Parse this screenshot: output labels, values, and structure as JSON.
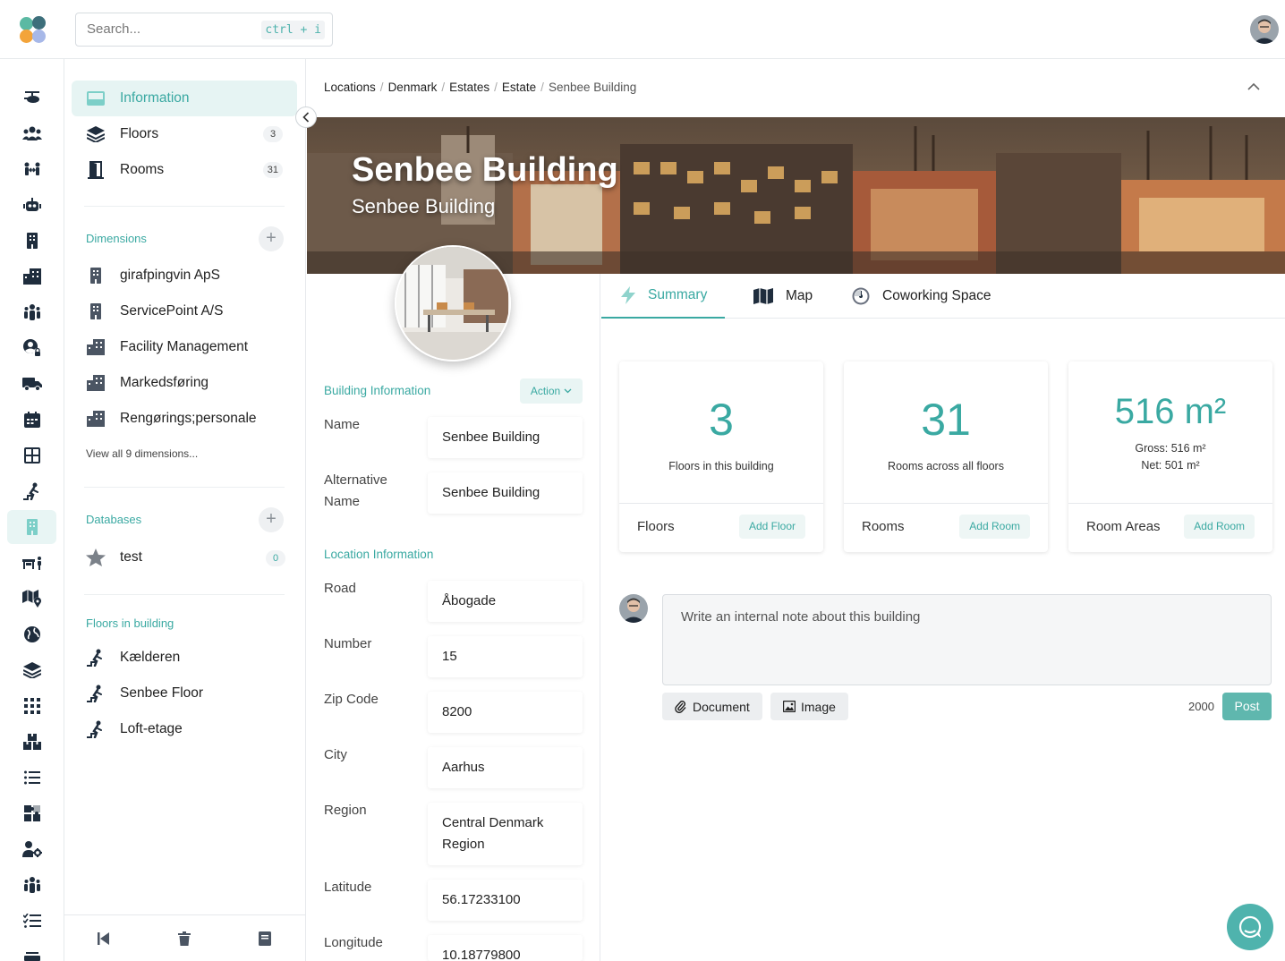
{
  "search": {
    "placeholder": "Search...",
    "shortcut": "ctrl + i"
  },
  "side": {
    "nav": [
      {
        "label": "Information"
      },
      {
        "label": "Floors",
        "count": "3"
      },
      {
        "label": "Rooms",
        "count": "31"
      }
    ],
    "dimensions_title": "Dimensions",
    "dimensions": [
      "girafpingvin ApS",
      "ServicePoint A/S",
      "Facility Management",
      "Markedsføring",
      "Rengørings;personale"
    ],
    "view_all": "View all 9 dimensions...",
    "databases_title": "Databases",
    "databases": [
      {
        "label": "test",
        "count": "0"
      }
    ],
    "floors_title": "Floors in building",
    "floors": [
      "Kælderen",
      "Senbee Floor",
      "Loft-etage"
    ]
  },
  "breadcrumb": [
    "Locations",
    "Denmark",
    "Estates",
    "Estate",
    "Senbee Building"
  ],
  "banner": {
    "title": "Senbee Building",
    "subtitle": "Senbee Building"
  },
  "info": {
    "building_title": "Building Information",
    "action_label": "Action",
    "location_title": "Location Information",
    "fields": {
      "name": {
        "label": "Name",
        "value": "Senbee Building"
      },
      "alt_name": {
        "label": "Alternative Name",
        "value": "Senbee Building"
      },
      "road": {
        "label": "Road",
        "value": "Åbogade"
      },
      "number": {
        "label": "Number",
        "value": "15"
      },
      "zip": {
        "label": "Zip Code",
        "value": "8200"
      },
      "city": {
        "label": "City",
        "value": "Aarhus"
      },
      "region": {
        "label": "Region",
        "value": "Central Denmark Region"
      },
      "latitude": {
        "label": "Latitude",
        "value": "56.17233100"
      },
      "longitude": {
        "label": "Longitude",
        "value": "10.18779800"
      }
    }
  },
  "tabs": [
    "Summary",
    "Map",
    "Coworking Space"
  ],
  "cards": {
    "floors": {
      "value": "3",
      "desc": "Floors in this building",
      "footer": "Floors",
      "button": "Add Floor"
    },
    "rooms": {
      "value": "31",
      "desc": "Rooms across all floors",
      "footer": "Rooms",
      "button": "Add Room"
    },
    "areas": {
      "value": "516 m²",
      "gross": "Gross: 516 m²",
      "net": "Net: 501 m²",
      "footer": "Room Areas",
      "button": "Add Room"
    }
  },
  "note": {
    "placeholder": "Write an internal note about this building",
    "document": "Document",
    "image": "Image",
    "chars": "2000",
    "post": "Post"
  },
  "colors": {
    "accent": "#3aa9a2",
    "accent_bg": "#e6f4f3"
  }
}
